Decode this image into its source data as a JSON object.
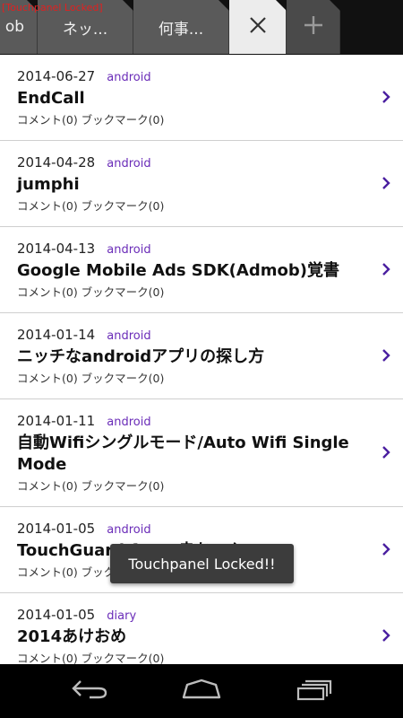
{
  "status_overlay": "[Touchpanel Locked]",
  "tabs": [
    {
      "label": "ob"
    },
    {
      "label": "ネッ..."
    },
    {
      "label": "何事..."
    }
  ],
  "active_tab_icon": "close-icon",
  "new_tab_icon": "plus-icon",
  "items": [
    {
      "date": "2014-06-27",
      "category": "android",
      "title": "EndCall",
      "meta": "コメント(0)  ブックマーク(0)"
    },
    {
      "date": "2014-04-28",
      "category": "android",
      "title": "jumphi",
      "meta": "コメント(0)  ブックマーク(0)"
    },
    {
      "date": "2014-04-13",
      "category": "android",
      "title": "Google Mobile Ads SDK(Admob)覚書",
      "meta": "コメント(0)  ブックマーク(0)"
    },
    {
      "date": "2014-01-14",
      "category": "android",
      "title": "ニッチなandroidアプリの探し方",
      "meta": "コメント(0)  ブックマーク(0)"
    },
    {
      "date": "2014-01-11",
      "category": "android",
      "title": "自動Wifiシングルモード/Auto Wifi Single Mode",
      "meta": "コメント(0)  ブックマーク(0)"
    },
    {
      "date": "2014-01-05",
      "category": "android",
      "title": "TouchGuard from 赤ちゃん",
      "meta": "コメント(0)  ブックマーク(0)"
    },
    {
      "date": "2014-01-05",
      "category": "diary",
      "title": "2014あけおめ",
      "meta": "コメント(0)  ブックマーク(0)"
    }
  ],
  "toast": "Touchpanel Locked!!",
  "colors": {
    "category": "#6a2cb8",
    "chevron": "#4a1fa0",
    "overlay_text": "#e02020"
  },
  "navbar": {
    "icons": [
      "back-icon",
      "home-icon",
      "recent-apps-icon"
    ]
  }
}
